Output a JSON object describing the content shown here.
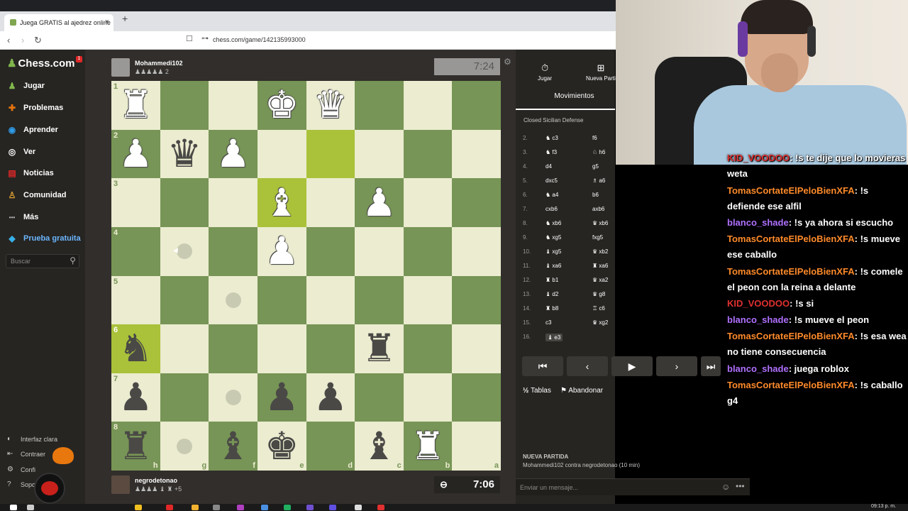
{
  "browser": {
    "tab_title": "Juega GRATIS al ajedrez online",
    "tab_close": "×",
    "new_tab": "+",
    "url": "chess.com/game/142135993000",
    "back": "‹",
    "forward": "›",
    "reload": "↻"
  },
  "sidebar": {
    "logo": "Chess.com",
    "notif_count": "1",
    "items": [
      {
        "label": "Jugar",
        "icon": "pawn-icon",
        "glyph": "♟"
      },
      {
        "label": "Problemas",
        "icon": "puzzle-icon",
        "glyph": "✚"
      },
      {
        "label": "Aprender",
        "icon": "graduation-icon",
        "glyph": "◉"
      },
      {
        "label": "Ver",
        "icon": "binoculars-icon",
        "glyph": "◎"
      },
      {
        "label": "Noticias",
        "icon": "news-icon",
        "glyph": "▤"
      },
      {
        "label": "Comunidad",
        "icon": "community-icon",
        "glyph": "♙"
      },
      {
        "label": "Más",
        "icon": "more-icon",
        "glyph": "•••"
      },
      {
        "label": "Prueba gratuita",
        "icon": "diamond-icon",
        "glyph": "◆"
      }
    ],
    "search_placeholder": "Buscar",
    "bottom": [
      {
        "label": "Interfaz clara",
        "glyph": "◐"
      },
      {
        "label": "Contraer",
        "glyph": "⇤"
      },
      {
        "label": "Confi",
        "glyph": "⚙"
      },
      {
        "label": "Sopo",
        "glyph": "?"
      }
    ]
  },
  "opponent": {
    "name": "Mohammedi102",
    "material": "♟♟♟♟♟ 2",
    "clock": "7:24"
  },
  "me": {
    "name": "negrodetonao",
    "material": "♟♟♟♟ ♝ ♜ +5",
    "clock": "7:06"
  },
  "board": {
    "ranks": [
      "1",
      "2",
      "3",
      "4",
      "5",
      "6",
      "7",
      "8"
    ],
    "files": [
      "h",
      "g",
      "f",
      "e",
      "d",
      "c",
      "b",
      "a"
    ],
    "rows": [
      [
        "wR",
        "",
        "",
        "wK",
        "wQ",
        "",
        "",
        ""
      ],
      [
        "wP",
        "bQ",
        "wP",
        "",
        "",
        "",
        "",
        ""
      ],
      [
        "",
        "",
        "",
        "wB",
        "",
        "wP",
        "",
        ""
      ],
      [
        "",
        "dot",
        "",
        "wP",
        "",
        "",
        "",
        ""
      ],
      [
        "",
        "",
        "dot",
        "",
        "",
        "",
        "",
        ""
      ],
      [
        "bN",
        "",
        "",
        "",
        "",
        "bR",
        "",
        ""
      ],
      [
        "bP",
        "",
        "dot",
        "bP",
        "bP",
        "",
        "",
        ""
      ],
      [
        "bR",
        "dot",
        "bB",
        "bK",
        "",
        "bB",
        "wR",
        ""
      ]
    ],
    "highlights": [
      [
        1,
        4
      ],
      [
        2,
        3
      ],
      [
        5,
        0
      ]
    ]
  },
  "panel": {
    "tab_play": "Jugar",
    "tab_new": "Nueva Parti",
    "title": "Movimientos",
    "opening": "Closed Sicilian Defense",
    "moves": [
      {
        "n": "2.",
        "w": "♞ c3",
        "b": "f6"
      },
      {
        "n": "3.",
        "w": "♞ f3",
        "b": "♘ h6"
      },
      {
        "n": "4.",
        "w": "d4",
        "b": "g5"
      },
      {
        "n": "5.",
        "w": "dxc5",
        "b": "♗ a6"
      },
      {
        "n": "6.",
        "w": "♞ a4",
        "b": "b6"
      },
      {
        "n": "7.",
        "w": "cxb6",
        "b": "axb6"
      },
      {
        "n": "8.",
        "w": "♞ xb6",
        "b": "♛ xb6"
      },
      {
        "n": "9.",
        "w": "♞ xg5",
        "b": "fxg5"
      },
      {
        "n": "10.",
        "w": "♝ xg5",
        "b": "♛ xb2"
      },
      {
        "n": "11.",
        "w": "♝ xa6",
        "b": "♜ xa6"
      },
      {
        "n": "12.",
        "w": "♜ b1",
        "b": "♛ xa2"
      },
      {
        "n": "13.",
        "w": "♝ d2",
        "b": "♛ g8"
      },
      {
        "n": "14.",
        "w": "♜ b8",
        "b": "♖ c6"
      },
      {
        "n": "15.",
        "w": "c3",
        "b": "♛ xg2"
      },
      {
        "n": "16.",
        "w": "♝ e3",
        "b": ""
      }
    ],
    "controls": [
      "⏮",
      "‹",
      "▶",
      "›",
      "⏭"
    ],
    "draw": "Tablas",
    "draw_icon": "½",
    "resign": "Abandonar",
    "resign_icon": "⚑",
    "new_game_title": "NUEVA PARTIDA",
    "new_game_desc": "Mohammedi102 contra negrodetonao (10 min)",
    "message_placeholder": "Enviar un mensaje...",
    "emoji": "☺",
    "more": "•••"
  },
  "chat": [
    {
      "user": "KID_VOODOO",
      "color": "#e03030",
      "text": ": !s te dije que lo movieras weta"
    },
    {
      "user": "TomasCortateElPeloBienXFA",
      "color": "#ff8a2a",
      "text": ": !s defiende ese alfil"
    },
    {
      "user": "blanco_shade",
      "color": "#b070ff",
      "text": ": !s ya ahora si escucho"
    },
    {
      "user": "TomasCortateElPeloBienXFA",
      "color": "#ff8a2a",
      "text": ": !s mueve ese caballo"
    },
    {
      "user": "TomasCortateElPeloBienXFA",
      "color": "#ff8a2a",
      "text": ": !s comele el peon con la reina a delante"
    },
    {
      "user": "KID_VOODOO",
      "color": "#e03030",
      "text": ": !s si"
    },
    {
      "user": "blanco_shade",
      "color": "#b070ff",
      "text": ": !s mueve el peon"
    },
    {
      "user": "TomasCortateElPeloBienXFA",
      "color": "#ff8a2a",
      "text": ": !s esa wea no tiene consecuencia"
    },
    {
      "user": "blanco_shade",
      "color": "#b070ff",
      "text": ": juega roblox"
    },
    {
      "user": "TomasCortateElPeloBienXFA",
      "color": "#ff8a2a",
      "text": ": !s caballo g4"
    }
  ],
  "taskbar": {
    "time": "09:13 p. m."
  }
}
